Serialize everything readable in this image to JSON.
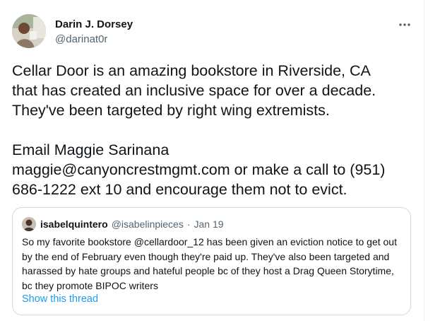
{
  "tweet": {
    "author": {
      "display_name": "Darin J. Dorsey",
      "handle": "@darinat0r"
    },
    "more_icon": "more-horizontal-icon",
    "text": "Cellar Door is an amazing bookstore in Riverside, CA\nthat has created an inclusive space for over a decade.\nThey've been targeted by right wing extremists.\n\n Email Maggie Sarinana\nmaggie@canyoncrestmgmt.com or make a call to (951)\n686-1222 ext 10 and encourage them not to evict."
  },
  "quoted_tweet": {
    "author": {
      "display_name": "isabelquintero",
      "handle": "@isabelinpieces"
    },
    "separator": "·",
    "date": "Jan 19",
    "text": "So my favorite bookstore @cellardoor_12 has been given an eviction notice to get out by the end of February even though they're paid up. They've also been targeted and harassed by hate groups and hateful people bc of they host a Drag Queen Storytime, bc they promote BIPOC writers",
    "show_thread_label": "Show this thread"
  },
  "colors": {
    "text_primary": "#0f1419",
    "text_secondary": "#536471",
    "link": "#1d9bf0",
    "border": "#cfd9de"
  }
}
